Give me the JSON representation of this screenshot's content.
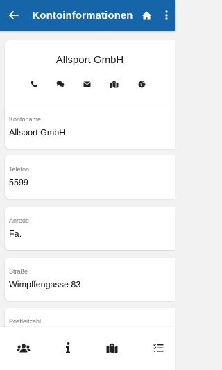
{
  "appbar": {
    "title": "Kontoinformationen",
    "back_icon": "arrow-left-icon",
    "home_icon": "home-icon",
    "more_icon": "more-vert-icon",
    "color": "#1565a8"
  },
  "header": {
    "company_name": "Allsport GmbH",
    "actions": [
      {
        "name": "call-button",
        "icon": "phone-icon"
      },
      {
        "name": "chat-button",
        "icon": "chat-icon"
      },
      {
        "name": "email-button",
        "icon": "envelope-icon"
      },
      {
        "name": "map-button",
        "icon": "map-marker-icon"
      },
      {
        "name": "website-button",
        "icon": "globe-icon"
      }
    ]
  },
  "fields": [
    {
      "label": "Kontoname",
      "value": "Allsport GmbH"
    },
    {
      "label": "Telefon",
      "value": "5599"
    },
    {
      "label": "Anrede",
      "value": "Fa."
    },
    {
      "label": "Straße",
      "value": "Wimpffengasse 83"
    },
    {
      "label": "Postleitzahl",
      "value": ""
    }
  ],
  "bottom_nav": [
    {
      "name": "nav-contacts",
      "icon": "users-icon"
    },
    {
      "name": "nav-info",
      "icon": "info-icon"
    },
    {
      "name": "nav-map",
      "icon": "map-marker-icon"
    },
    {
      "name": "nav-tasks",
      "icon": "tasks-list-icon"
    }
  ]
}
